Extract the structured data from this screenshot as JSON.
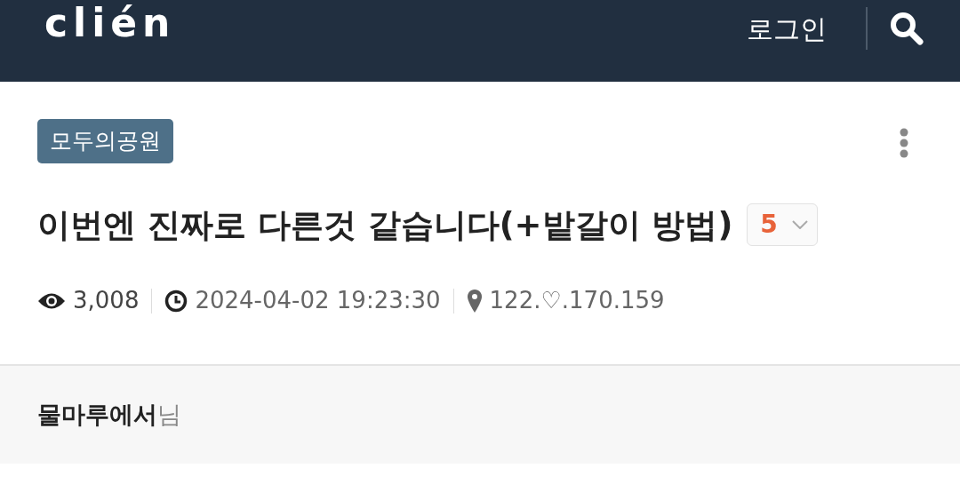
{
  "header": {
    "logo": "clién",
    "login": "로그인"
  },
  "post": {
    "board_tag": "모두의공원",
    "title": "이번엔 진짜로 다른것 같습니다(+밭갈이 방법)",
    "comment_count": "5",
    "meta": [
      {
        "kind": "views",
        "text": "3,008"
      },
      {
        "kind": "time",
        "text": "2024-04-02 19:23:30"
      },
      {
        "kind": "ip",
        "text": "122.♡.170.159"
      }
    ]
  },
  "author": {
    "name": "물마루에서",
    "suffix": "님"
  }
}
